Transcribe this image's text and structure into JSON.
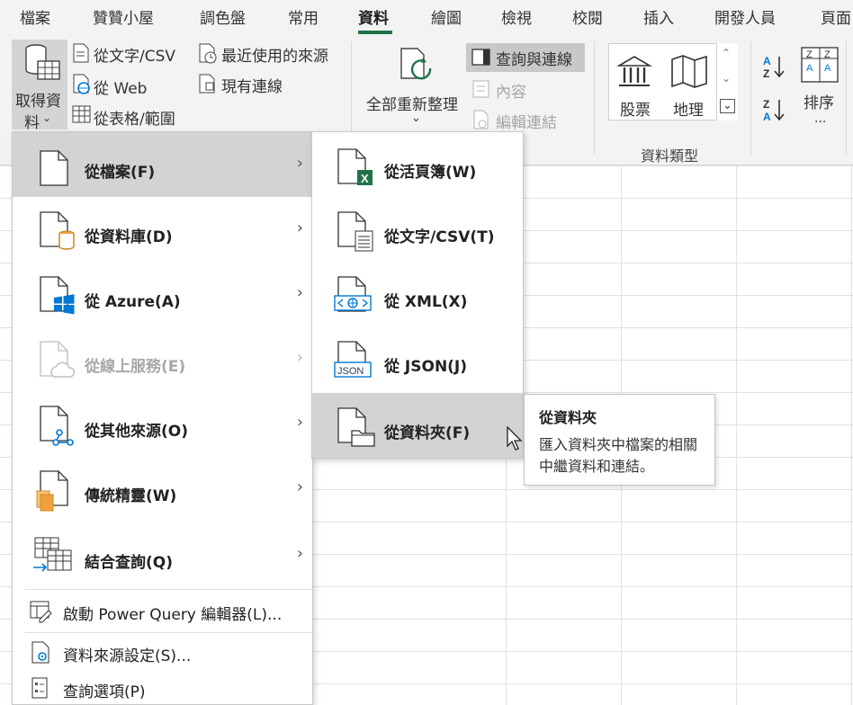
{
  "tabs": [
    "檔案",
    "贊贊小屋",
    "調色盤",
    "常用",
    "資料",
    "繪圖",
    "檢視",
    "校閱",
    "插入",
    "開發人員",
    "頁面"
  ],
  "active_tab": "資料",
  "ribbon": {
    "get_data_line1": "取得資",
    "get_data_line2": "料",
    "from_text_csv": "從文字/CSV",
    "from_web": "從 Web",
    "from_table": "從表格/範圍",
    "recent_sources": "最近使用的來源",
    "existing_connections": "現有連線",
    "refresh_all": "全部重新整理",
    "queries_connections": "查詢與連線",
    "properties": "內容",
    "edit_links": "編輯連結",
    "stocks": "股票",
    "geography": "地理",
    "data_types_group": "資料類型",
    "sort": "排序",
    "sort_more": "..."
  },
  "main_menu": {
    "from_file": "從檔案(F)",
    "from_database": "從資料庫(D)",
    "from_azure": "從 Azure(A)",
    "from_online": "從線上服務(E)",
    "from_other": "從其他來源(O)",
    "legacy_wizards": "傳統精靈(W)",
    "combine_queries": "結合查詢(Q)",
    "launch_pq": "啟動 Power Query 編輯器(L)...",
    "source_settings": "資料來源設定(S)...",
    "query_options": "查詢選項(P)"
  },
  "sub_menu": {
    "from_workbook": "從活頁簿(W)",
    "from_text_csv": "從文字/CSV(T)",
    "from_xml": "從 XML(X)",
    "from_json": "從 JSON(J)",
    "from_folder": "從資料夾(F)"
  },
  "tooltip": {
    "title": "從資料夾",
    "body": "匯入資料夾中檔案的相關中繼資料和連結。"
  },
  "icons": {
    "excel_badge": "X",
    "json_badge": "JSON"
  },
  "colors": {
    "accent_green": "#217346",
    "azure_blue": "#0078d4",
    "db_orange": "#f0a23a",
    "highlight_gray": "#d3d3d3"
  }
}
